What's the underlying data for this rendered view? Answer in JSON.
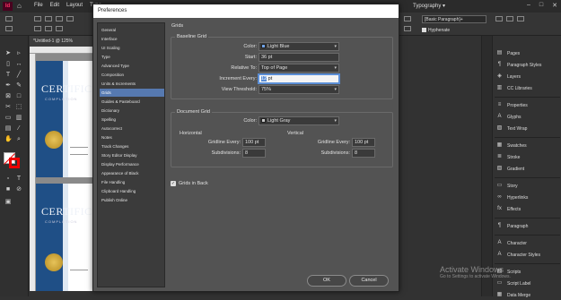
{
  "app": {
    "logo": "Id",
    "menus": [
      "File",
      "Edit",
      "Layout",
      "Type"
    ],
    "workspace": "Typography ▾",
    "paragraph_style": "[Basic Paragraph]+",
    "hyphenate_label": "Hyphenate"
  },
  "document": {
    "tab_label": "*Untitled-1 @ 125%",
    "certificate_title": "CERTIFICATE",
    "certificate_sub": "COMPLETION"
  },
  "dialog": {
    "title": "Preferences",
    "categories": [
      "General",
      "Interface",
      "UI Scaling",
      "Type",
      "Advanced Type",
      "Composition",
      "Units & Increments",
      "Grids",
      "Guides & Pasteboard",
      "Dictionary",
      "Spelling",
      "Autocorrect",
      "Notes",
      "Track Changes",
      "Story Editor Display",
      "Display Performance",
      "Appearance of Black",
      "File Handling",
      "Clipboard Handling",
      "Publish Online"
    ],
    "selected_category": "Grids",
    "section_title": "Grids",
    "baseline": {
      "heading": "Baseline Grid",
      "color_label": "Color:",
      "color_value": "Light Blue",
      "color_swatch": "#6fa3e8",
      "start_label": "Start:",
      "start_value": "36 pt",
      "relative_label": "Relative To:",
      "relative_value": "Top of Page",
      "increment_label": "Increment Every:",
      "increment_value": "12",
      "increment_unit": " pt",
      "threshold_label": "View Threshold:",
      "threshold_value": "75%"
    },
    "document_grid": {
      "heading": "Document Grid",
      "color_label": "Color:",
      "color_value": "Light Gray",
      "color_swatch": "#c8c8c8",
      "horizontal": {
        "heading": "Horizontal",
        "gridline_label": "Gridline Every:",
        "gridline_value": "100 pt",
        "subdivisions_label": "Subdivisions:",
        "subdivisions_value": "8"
      },
      "vertical": {
        "heading": "Vertical",
        "gridline_label": "Gridline Every:",
        "gridline_value": "100 pt",
        "subdivisions_label": "Subdivisions:",
        "subdivisions_value": "8"
      }
    },
    "grids_in_back_label": "Grids in Back",
    "ok_label": "OK",
    "cancel_label": "Cancel"
  },
  "panels": [
    {
      "label": "Pages",
      "icon": "pages-icon",
      "glyph": "▤"
    },
    {
      "label": "Paragraph Styles",
      "icon": "paragraph-styles-icon",
      "glyph": "¶"
    },
    {
      "label": "Layers",
      "icon": "layers-icon",
      "glyph": "◈"
    },
    {
      "label": "CC Libraries",
      "icon": "cc-libraries-icon",
      "glyph": "▥"
    },
    {
      "label": "Properties",
      "icon": "properties-icon",
      "glyph": "≡"
    },
    {
      "label": "Glyphs",
      "icon": "glyphs-icon",
      "glyph": "A"
    },
    {
      "label": "Text Wrap",
      "icon": "text-wrap-icon",
      "glyph": "▨"
    },
    {
      "label": "Swatches",
      "icon": "swatches-icon",
      "glyph": "▦"
    },
    {
      "label": "Stroke",
      "icon": "stroke-icon",
      "glyph": "≣"
    },
    {
      "label": "Gradient",
      "icon": "gradient-icon",
      "glyph": "▧"
    },
    {
      "label": "Story",
      "icon": "story-icon",
      "glyph": "▭"
    },
    {
      "label": "Hyperlinks",
      "icon": "hyperlinks-icon",
      "glyph": "∞"
    },
    {
      "label": "Effects",
      "icon": "effects-icon",
      "glyph": "fx"
    },
    {
      "label": "Paragraph",
      "icon": "paragraph-icon",
      "glyph": "¶"
    },
    {
      "label": "Character",
      "icon": "character-icon",
      "glyph": "A"
    },
    {
      "label": "Character Styles",
      "icon": "character-styles-icon",
      "glyph": "A"
    },
    {
      "label": "Scripts",
      "icon": "scripts-icon",
      "glyph": "▤"
    },
    {
      "label": "Script Label",
      "icon": "script-label-icon",
      "glyph": "▭"
    },
    {
      "label": "Data Merge",
      "icon": "data-merge-icon",
      "glyph": "▦"
    }
  ],
  "watermark": {
    "title": "Activate Windows",
    "sub": "Go to Settings to activate Windows."
  }
}
